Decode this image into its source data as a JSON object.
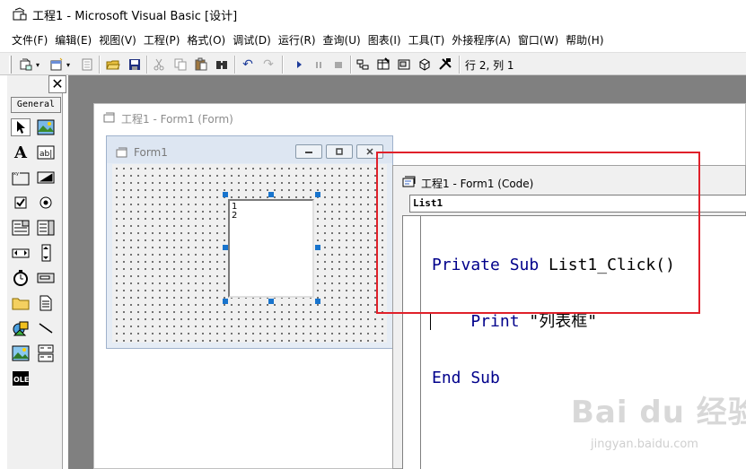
{
  "window": {
    "title": "工程1 - Microsoft Visual Basic [设计]"
  },
  "menu": [
    "文件(F)",
    "编辑(E)",
    "视图(V)",
    "工程(P)",
    "格式(O)",
    "调试(D)",
    "运行(R)",
    "查询(U)",
    "图表(I)",
    "工具(T)",
    "外接程序(A)",
    "窗口(W)",
    "帮助(H)"
  ],
  "toolbar": {
    "position_label": "行 2, 列 1"
  },
  "toolbox": {
    "close_glyph": "✕",
    "tab_label": "General"
  },
  "designer": {
    "title": "工程1 - Form1 (Form)"
  },
  "form1": {
    "title": "Form1",
    "list_items": [
      "1",
      "2"
    ]
  },
  "code_window": {
    "title": "工程1 - Form1 (Code)",
    "object_combo": "List1",
    "lines": [
      {
        "keyword": "Private Sub",
        "rest": " List1_Click()"
      },
      {
        "keyword": "    Print",
        "rest": " \"列表框\""
      },
      {
        "keyword": "End Sub",
        "rest": ""
      }
    ]
  },
  "watermark": {
    "logo": "Bai du 经验",
    "url": "jingyan.baidu.com"
  },
  "colors": {
    "highlight": "#e0202a",
    "mdi_background": "#808080",
    "keyword": "#00008b",
    "handle": "#1874cd"
  }
}
